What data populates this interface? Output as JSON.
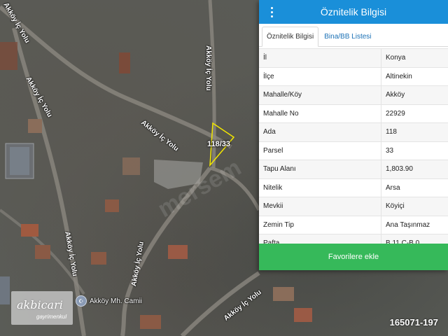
{
  "map": {
    "road_labels": [
      "Akköy İç Yolu",
      "Akköy İç Yolu",
      "Akköy İç Yolu",
      "Akköy İç Yolu",
      "Akköy İç Yolu",
      "Akköy İç Yolu",
      "Akköy İç Yolu"
    ],
    "parcel_label": "118/33",
    "poi_label": "Akköy Mh. Camii",
    "poi_icon": "mosque-icon",
    "watermark": "mersem",
    "logo": {
      "title": "akbicari",
      "subtitle": "gayrimenkul"
    },
    "listing_id": "165071-197"
  },
  "panel": {
    "title": "Öznitelik Bilgisi",
    "menu_icon": "more-vertical-icon",
    "tabs": [
      {
        "label": "Öznitelik Bilgisi",
        "active": true
      },
      {
        "label": "Bina/BB Listesi",
        "active": false
      }
    ],
    "rows": [
      {
        "key": "İl",
        "value": "Konya"
      },
      {
        "key": "İlçe",
        "value": "Altinekin"
      },
      {
        "key": "Mahalle/Köy",
        "value": "Akköy"
      },
      {
        "key": "Mahalle No",
        "value": "22929"
      },
      {
        "key": "Ada",
        "value": "118"
      },
      {
        "key": "Parsel",
        "value": "33"
      },
      {
        "key": "Tapu Alanı",
        "value": "1,803.90"
      },
      {
        "key": "Nitelik",
        "value": "Arsa"
      },
      {
        "key": "Mevkii",
        "value": "Köyiçi"
      },
      {
        "key": "Zemin Tip",
        "value": "Ana Taşınmaz"
      },
      {
        "key": "Pafta",
        "value": "B.11.C-B.0"
      }
    ],
    "favorite_button": "Favorilere ekle"
  },
  "colors": {
    "header": "#1a8fd9",
    "button": "#36b95a",
    "parcel_outline": "#f2e600"
  }
}
